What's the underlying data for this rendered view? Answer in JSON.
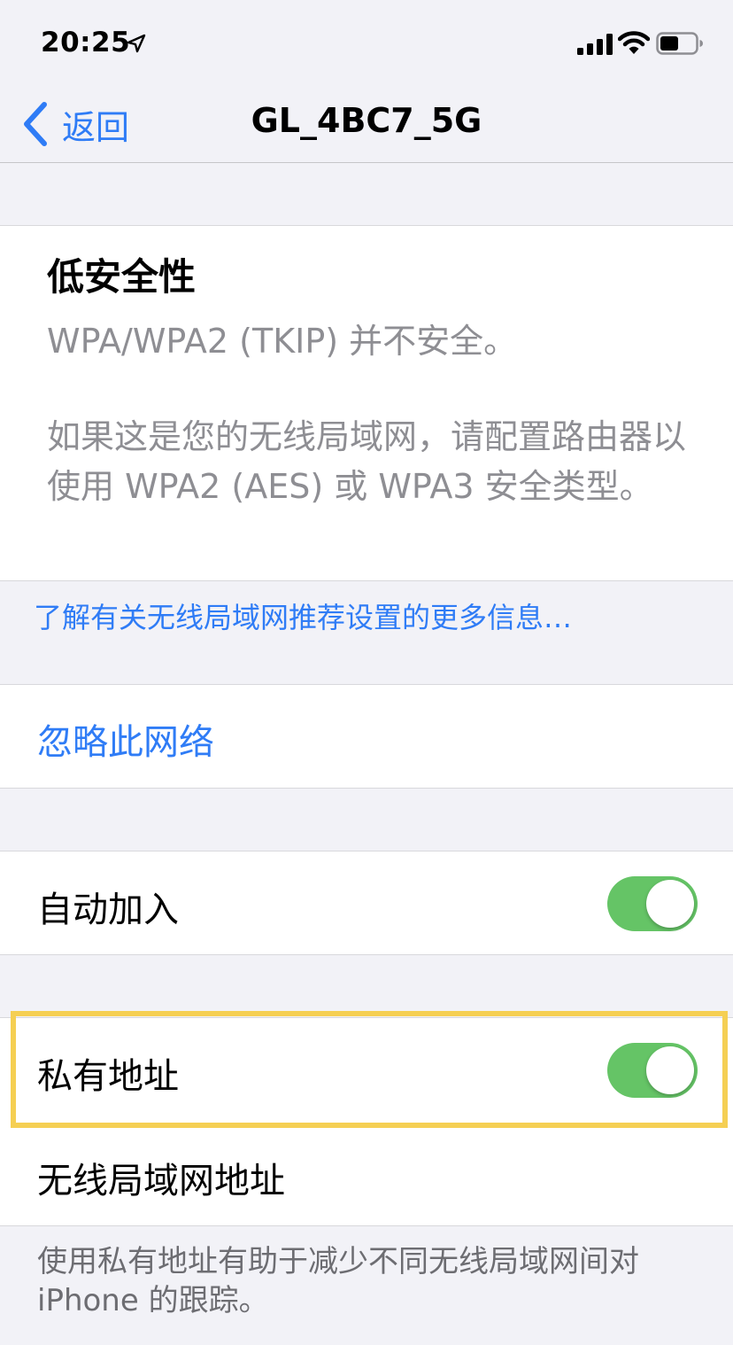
{
  "status_bar": {
    "time": "20:25",
    "icons": [
      "location-arrow-icon",
      "cellular-signal-icon",
      "wifi-icon",
      "battery-icon"
    ]
  },
  "nav": {
    "back_label": "返回",
    "title": "GL_4BC7_5G"
  },
  "security_warning": {
    "title": "低安全性",
    "line1": "WPA/WPA2 (TKIP) 并不安全。",
    "paragraph": "如果这是您的无线局域网，请配置路由器以使用 WPA2 (AES) 或 WPA3 安全类型。"
  },
  "learn_more_link": "了解有关无线局域网推荐设置的更多信息…",
  "forget_network": "忽略此网络",
  "auto_join": {
    "label": "自动加入",
    "on": true
  },
  "private_address": {
    "label": "私有地址",
    "on": true,
    "highlighted": true
  },
  "wlan_address": {
    "label": "无线局域网地址"
  },
  "footer_note": "使用私有地址有助于减少不同无线局域网间对 iPhone 的跟踪。",
  "colors": {
    "accent": "#2f7cf6",
    "toggle_on": "#65c466",
    "highlight": "#f5cf53",
    "background": "#f2f2f7"
  }
}
